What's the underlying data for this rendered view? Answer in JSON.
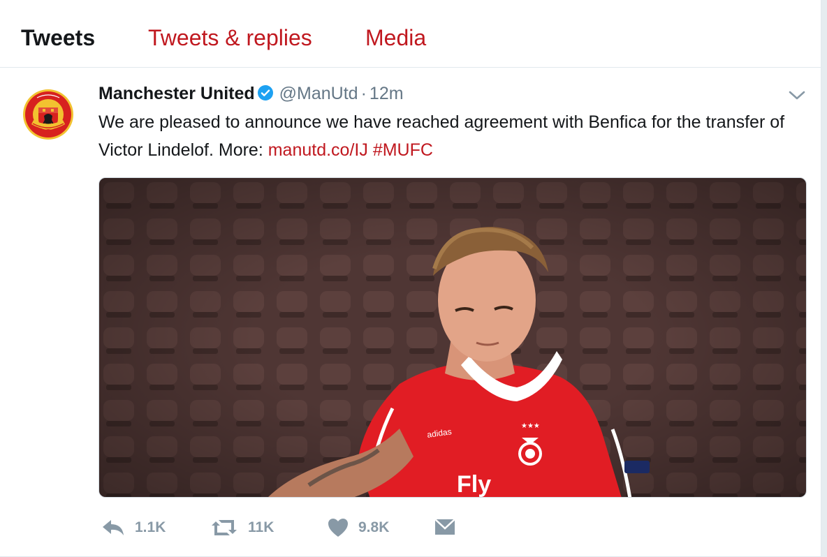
{
  "tabs": [
    {
      "label": "Tweets",
      "active": true
    },
    {
      "label": "Tweets & replies",
      "active": false
    },
    {
      "label": "Media",
      "active": false
    }
  ],
  "tweet": {
    "author_name": "Manchester United",
    "handle": "@ManUtd",
    "separator": "·",
    "time": "12m",
    "text_part1": "We are pleased to announce we have reached agreement with Benfica for the transfer of Victor Lindelof. More: ",
    "link": "manutd.co/IJ",
    "hashtag": "#MUFC",
    "media_description_icon": "player-photo",
    "avatar_icon": "manchester-united-crest-icon",
    "shirt_sponsor": "Fly",
    "shirt_brand": "adidas",
    "stats": {
      "replies": "1.1K",
      "retweets": "11K",
      "likes": "9.8K"
    }
  },
  "colors": {
    "accent": "#c0181f",
    "verified": "#1da1f2",
    "muted": "#8899a6",
    "text": "#14171a"
  }
}
